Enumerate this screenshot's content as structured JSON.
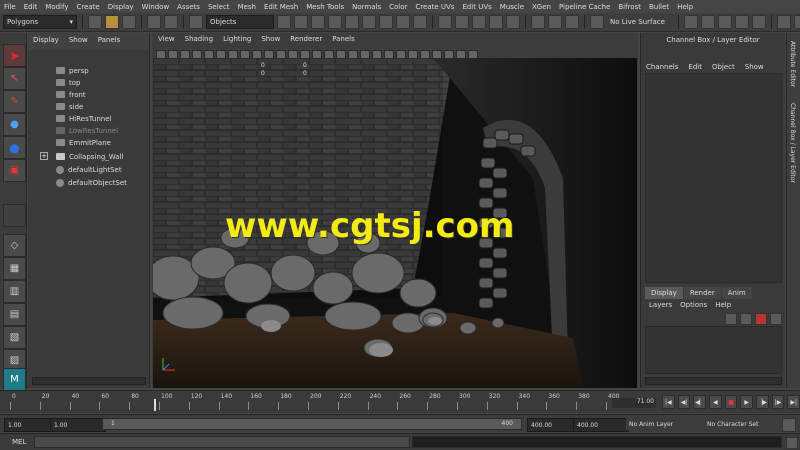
{
  "menu": [
    "File",
    "Edit",
    "Modify",
    "Create",
    "Display",
    "Window",
    "Assets",
    "Select",
    "Mesh",
    "Edit Mesh",
    "Mesh Tools",
    "Normals",
    "Color",
    "Create UVs",
    "Edit UVs",
    "Muscle",
    "XGen",
    "Pipeline Cache",
    "Bifrost",
    "Bullet",
    "Help"
  ],
  "toolbar": {
    "mode_value": "Polygons",
    "objects_label": "Objects",
    "live_surface": "No Live Surface"
  },
  "outliner": {
    "menu": [
      "Display",
      "Show",
      "Panels"
    ],
    "items": [
      "persp",
      "top",
      "front",
      "side",
      "HiResTunnel",
      "LowResTunnel",
      "EmmitPlane",
      "Collapsing_Wall",
      "defaultLightSet",
      "defaultObjectSet"
    ]
  },
  "viewport": {
    "menu": [
      "View",
      "Shading",
      "Lighting",
      "Show",
      "Renderer",
      "Panels"
    ],
    "hud_values": [
      "0",
      "0",
      "0",
      "0"
    ],
    "watermark": "www.cgtsj.com"
  },
  "channel_box": {
    "title": "Channel Box / Layer Editor",
    "menu": [
      "Channels",
      "Edit",
      "Object",
      "Show"
    ],
    "layer_tabs": [
      "Display",
      "Render",
      "Anim"
    ],
    "layer_menu": [
      "Layers",
      "Options",
      "Help"
    ]
  },
  "side_tabs": [
    "Attribute Editor",
    "Channel Box / Layer Editor"
  ],
  "timeline": {
    "ticks": [
      "0",
      "20",
      "40",
      "60",
      "80",
      "100",
      "120",
      "140",
      "160",
      "180",
      "200",
      "220",
      "240",
      "260",
      "280",
      "300",
      "320",
      "340",
      "360",
      "380",
      "400"
    ],
    "current_frame": "71.00"
  },
  "range": {
    "start": "1.00",
    "start2": "1.00",
    "slider_start": "1",
    "slider_end": "400",
    "end": "400.00",
    "end2": "400.00",
    "anim_layer": "No Anim Layer",
    "character_set": "No Character Set"
  },
  "command": {
    "label": "MEL"
  }
}
